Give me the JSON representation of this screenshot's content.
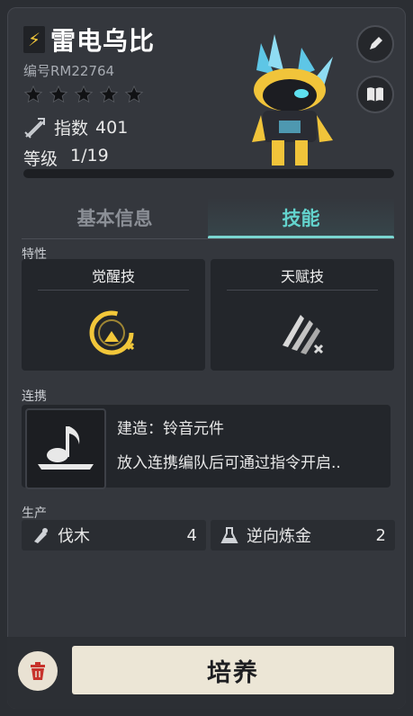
{
  "header": {
    "name": "雷电乌比",
    "code": "编号RM22764",
    "stars": 5,
    "index_label": "指数",
    "index_value": "401",
    "level_label": "等级",
    "level_value": "1/19",
    "level_progress": 0.0
  },
  "tabs": [
    {
      "label": "基本信息",
      "active": false
    },
    {
      "label": "技能",
      "active": true
    }
  ],
  "traits": {
    "label": "特性",
    "items": [
      {
        "title": "觉醒技",
        "icon": "awakening-skill-icon"
      },
      {
        "title": "天赋技",
        "icon": "talent-skill-icon"
      }
    ]
  },
  "link": {
    "label": "连携",
    "name": "建造：铃音元件",
    "desc": "放入连携编队后可通过指令开启..",
    "icon": "music-note-icon"
  },
  "production": {
    "label": "生产",
    "items": [
      {
        "name": "伐木",
        "value": "4",
        "icon": "logging-icon"
      },
      {
        "name": "逆向炼金",
        "value": "2",
        "icon": "flask-icon"
      }
    ]
  },
  "actions": {
    "train_label": "培养",
    "delete_icon": "trash-icon",
    "edit_icon": "pencil-icon",
    "book_icon": "book-icon"
  },
  "colors": {
    "accent": "#63d3cd",
    "gold": "#f2c73a",
    "button_bg": "#ece6d6"
  }
}
